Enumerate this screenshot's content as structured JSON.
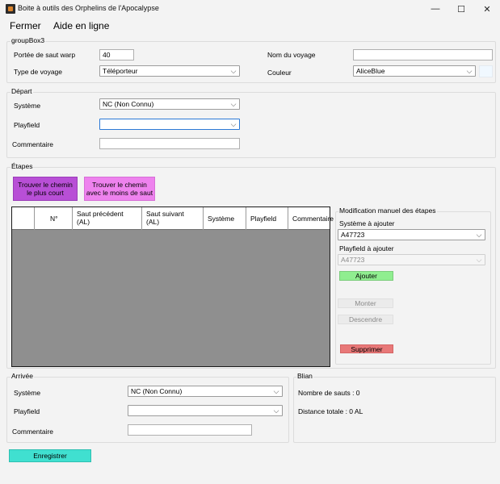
{
  "window": {
    "title": "Boite à outils des Orphelins de l'Apocalypse",
    "controls": [
      "—",
      "☐",
      "✕"
    ]
  },
  "menu": {
    "close": "Fermer",
    "help": "Aide en ligne"
  },
  "group_box3": {
    "title": "groupBox3",
    "warp_range_label": "Portée de saut warp",
    "warp_range_value": "40",
    "trip_type_label": "Type de voyage",
    "trip_type_value": "Téléporteur",
    "trip_name_label": "Nom du voyage",
    "trip_name_value": "",
    "color_label": "Couleur",
    "color_value": "AliceBlue",
    "color_swatch": "#f0f8ff"
  },
  "departure": {
    "title": "Départ",
    "system_label": "Système",
    "system_value": "NC (Non Connu)",
    "playfield_label": "Playfield",
    "playfield_value": "",
    "comment_label": "Commentaire",
    "comment_value": ""
  },
  "steps": {
    "title": "Étapes",
    "shortest_button": "Trouver le chemin\nle plus court",
    "least_jumps_button": "Trouver le chemin\navec le moins de saut",
    "columns": [
      "",
      "N°",
      "Saut précédent\n(AL)",
      "Saut suivant\n(AL)",
      "Système",
      "Playfield",
      "Commentaire"
    ],
    "rows": []
  },
  "manual": {
    "title": "Modification manuel des étapes",
    "system_label": "Système à ajouter",
    "system_value": "A47723",
    "playfield_label": "Playfield à ajouter",
    "playfield_value": "A47723",
    "add_button": "Ajouter",
    "up_button": "Monter",
    "down_button": "Descendre",
    "delete_button": "Supprimer"
  },
  "arrival": {
    "title": "Arrivée",
    "system_label": "Système",
    "system_value": "NC (Non Connu)",
    "playfield_label": "Playfield",
    "playfield_value": "",
    "comment_label": "Commentaire",
    "comment_value": ""
  },
  "summary": {
    "title": "Blian",
    "jumps": "Nombre de sauts : 0",
    "distance": "Distance totale : 0 AL"
  },
  "save_button": "Enregistrer",
  "colors": {
    "shortest_button": "#b84fd6",
    "least_jumps_button": "#ee82ee",
    "add_button": "#90ee90",
    "delete_button": "#e87878",
    "save_button": "#40e0d0",
    "grid_background": "#8f8f8f"
  }
}
